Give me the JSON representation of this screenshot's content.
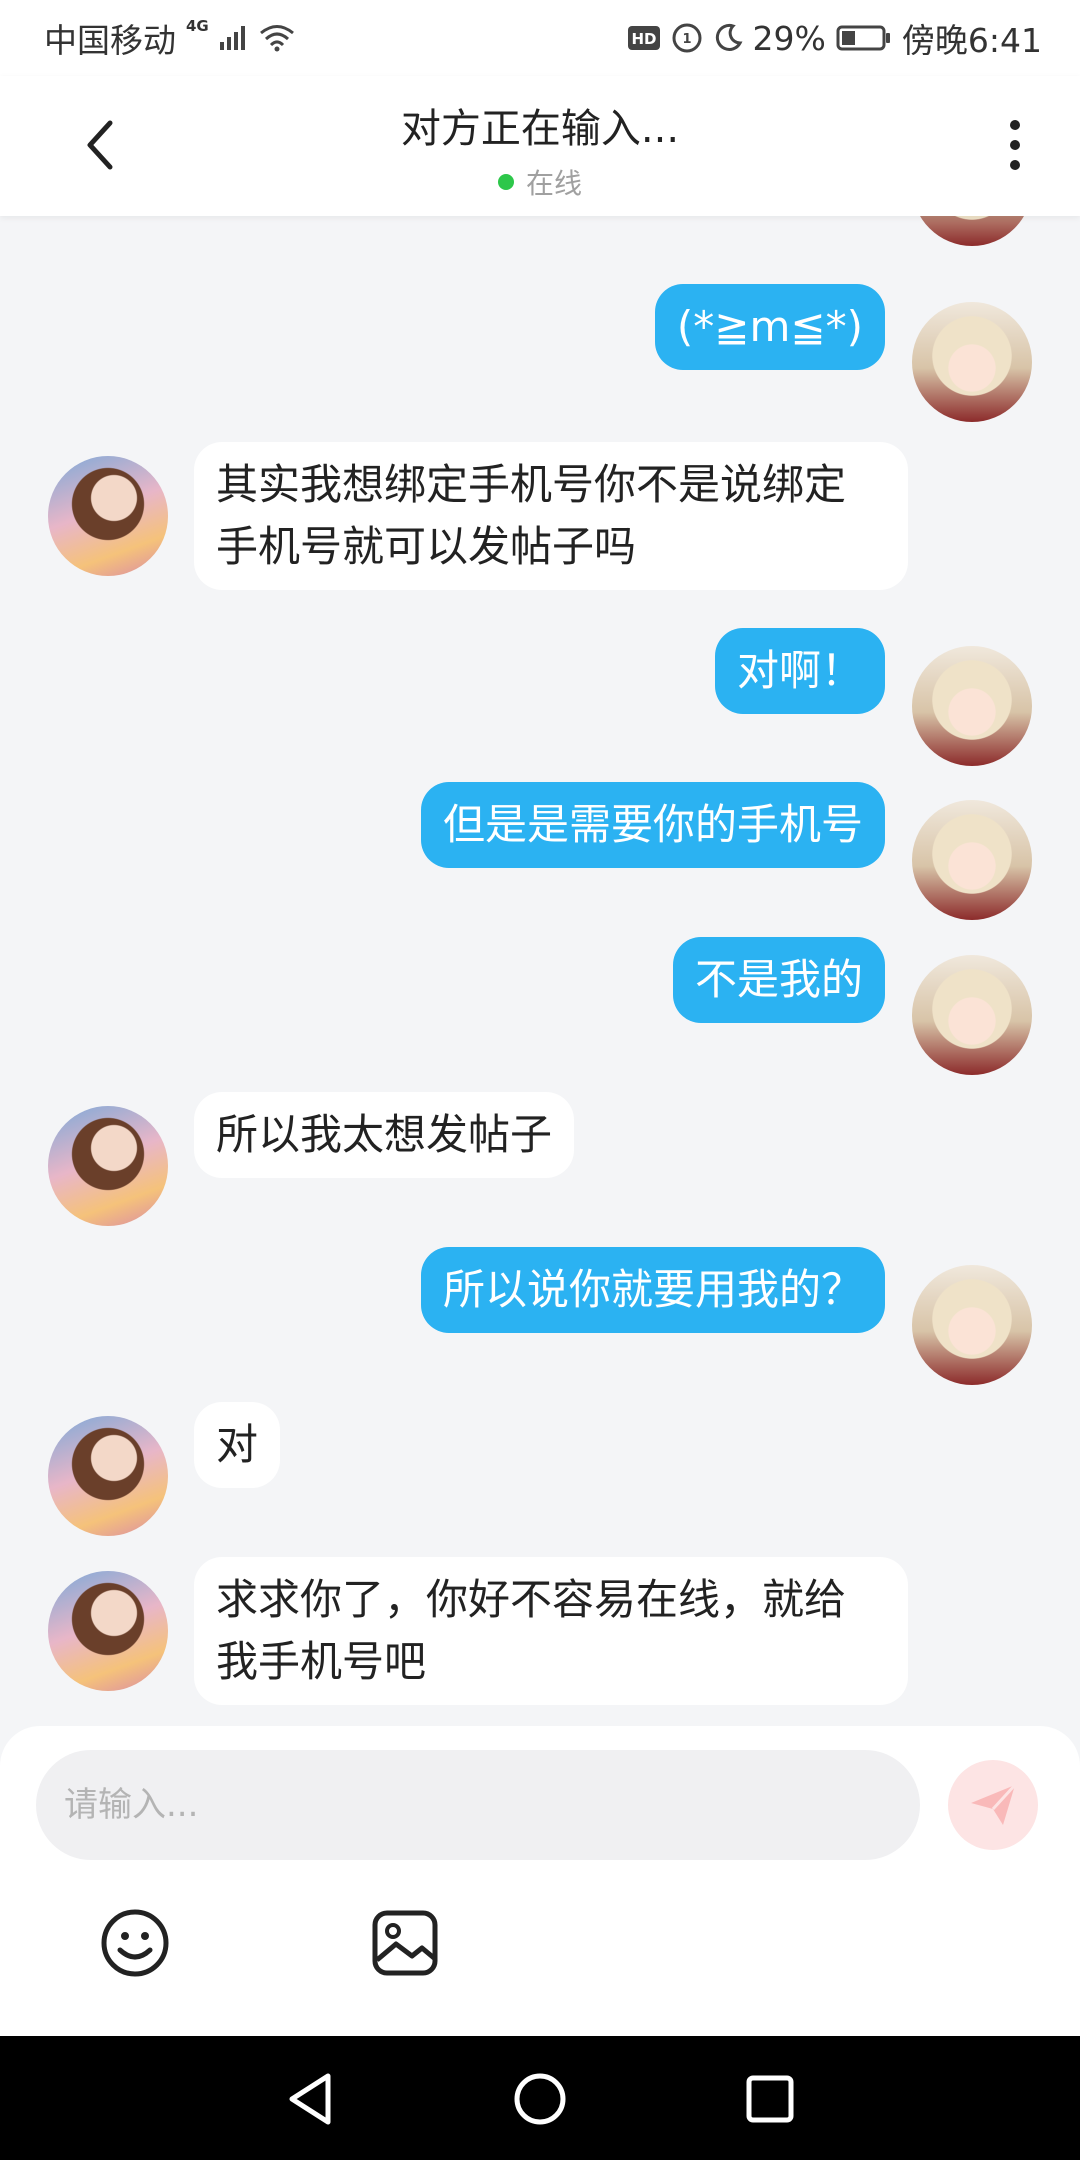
{
  "status_bar": {
    "carrier": "中国移动",
    "network": "4G",
    "battery": "29%",
    "time": "傍晚6:41",
    "icons": [
      "signal-icon",
      "wifi-icon",
      "hd-icon",
      "data-speed-icon",
      "moon-icon",
      "battery-icon"
    ]
  },
  "header": {
    "title": "对方正在输入...",
    "status": "在线",
    "status_color": "#2dc74a",
    "back_icon": "chevron-left-icon",
    "more_icon": "more-vertical-icon"
  },
  "messages": [
    {
      "from": "self",
      "text": "(*≧m≦*)"
    },
    {
      "from": "peer",
      "text": "其实我想绑定手机号你不是说绑定手机号就可以发帖子吗"
    },
    {
      "from": "self",
      "text": "对啊！"
    },
    {
      "from": "self",
      "text": "但是是需要你的手机号"
    },
    {
      "from": "self",
      "text": "不是我的"
    },
    {
      "from": "peer",
      "text": "所以我太想发帖子"
    },
    {
      "from": "self",
      "text": "所以说你就要用我的？"
    },
    {
      "from": "peer",
      "text": "对"
    },
    {
      "from": "peer",
      "text": "求求你了，你好不容易在线，就给我手机号吧"
    }
  ],
  "composer": {
    "placeholder": "请输入...",
    "send_icon": "paper-plane-icon",
    "tools": [
      "smiley-icon",
      "image-icon"
    ]
  },
  "nav_bar": {
    "buttons": [
      "back-triangle-icon",
      "home-circle-icon",
      "recents-square-icon"
    ]
  },
  "colors": {
    "self_bubble": "#2bb2f2",
    "peer_bubble": "#ffffff",
    "background": "#f4f5f7"
  }
}
